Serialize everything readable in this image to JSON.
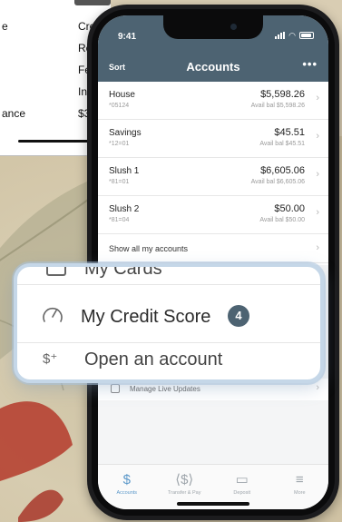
{
  "background_doc": {
    "rows": [
      {
        "left": "e",
        "right": "Cre"
      },
      {
        "left": "",
        "right": "Re"
      },
      {
        "left": "",
        "right": "Fe"
      },
      {
        "left": "",
        "right": "Int"
      },
      {
        "left": "ance",
        "right": "$3"
      }
    ]
  },
  "status_bar": {
    "time": "9:41"
  },
  "nav": {
    "sort_label": "Sort",
    "title": "Accounts",
    "more_label": "•••"
  },
  "accounts": [
    {
      "name": "House",
      "number": "*05124",
      "balance": "$5,598.26",
      "available": "Avail bal $5,598.26"
    },
    {
      "name": "Savings",
      "number": "*12=01",
      "balance": "$45.51",
      "available": "Avail bal $45.51"
    },
    {
      "name": "Slush 1",
      "number": "*81=01",
      "balance": "$6,605.06",
      "available": "Avail bal $6,605.06"
    },
    {
      "name": "Slush 2",
      "number": "*81=04",
      "balance": "$50.00",
      "available": "Avail bal $50.00"
    }
  ],
  "show_all_label": "Show all my accounts",
  "manage_live_updates_label": "Manage Live Updates",
  "callout": {
    "cards_label": "My Cards",
    "credit_score_label": "My Credit Score",
    "credit_score_badge": "4",
    "open_account_label": "Open an account"
  },
  "tabbar": [
    {
      "label": "Accounts",
      "icon": "dollar-icon",
      "glyph": "$",
      "active": true
    },
    {
      "label": "Transfer & Pay",
      "icon": "transfer-icon",
      "glyph": "⟨$⟩",
      "active": false
    },
    {
      "label": "Deposit",
      "icon": "deposit-icon",
      "glyph": "▭",
      "active": false
    },
    {
      "label": "More",
      "icon": "menu-icon",
      "glyph": "≡",
      "active": false
    }
  ],
  "colors": {
    "header": "#4d6372",
    "accent": "#5b98c9",
    "callout_border": "#c5d7e8"
  }
}
